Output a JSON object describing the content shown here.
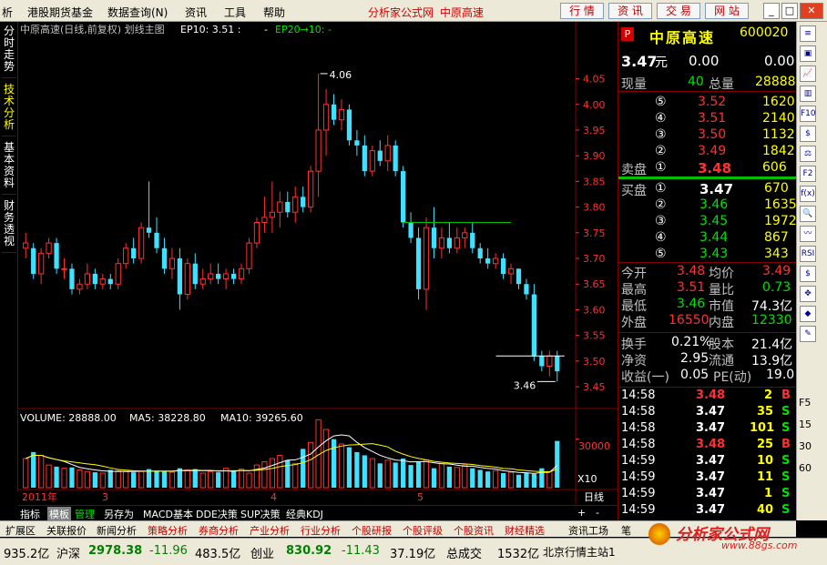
{
  "menu": {
    "items": [
      "析",
      "港股期货基金",
      "数据查询(N)",
      "资讯",
      "工具",
      "帮助"
    ],
    "brand_1": "分析家公式网",
    "brand_2": "中原高速",
    "top_buttons": [
      "行 情",
      "资 讯",
      "交 易",
      "网 站"
    ],
    "window_buttons": [
      "_",
      "□",
      "✕"
    ]
  },
  "left_tabs": [
    "分时走势",
    "技术分析",
    "基本资料",
    "财务透视"
  ],
  "chart_header": {
    "title": "中原高速(日线,前复权) 划线主图",
    "ep10": "EP10: 3.51 :",
    "dash": "-",
    "ep20": "EP20→10: -"
  },
  "volume_header": {
    "volume": "VOLUME: 28888.00",
    "ma5": "MA5: 38228.80",
    "ma10": "MA10: 39265.60"
  },
  "x_axis_labels": [
    "2011年",
    "3",
    "4",
    "5"
  ],
  "period_label": "日线",
  "x10_label": "X10",
  "vol_axis_label": "30000",
  "chart_data": {
    "type": "candlestick",
    "price_ylim": [
      3.42,
      4.09
    ],
    "price_ticks": [
      "4.05",
      "4.00",
      "3.95",
      "3.90",
      "3.85",
      "3.80",
      "3.75",
      "3.70",
      "3.65",
      "3.60",
      "3.55",
      "3.50",
      "3.45"
    ],
    "high_label": "4.06",
    "low_label": "3.46",
    "candles": [
      [
        3.73,
        3.75,
        3.7,
        3.72,
        1
      ],
      [
        3.72,
        3.73,
        3.66,
        3.67,
        0
      ],
      [
        3.67,
        3.72,
        3.65,
        3.71,
        1
      ],
      [
        3.71,
        3.74,
        3.7,
        3.73,
        1
      ],
      [
        3.73,
        3.74,
        3.67,
        3.68,
        0
      ],
      [
        3.68,
        3.7,
        3.66,
        3.68,
        1
      ],
      [
        3.68,
        3.69,
        3.63,
        3.64,
        0
      ],
      [
        3.64,
        3.66,
        3.63,
        3.65,
        1
      ],
      [
        3.65,
        3.69,
        3.64,
        3.67,
        1
      ],
      [
        3.67,
        3.68,
        3.64,
        3.65,
        0
      ],
      [
        3.65,
        3.67,
        3.64,
        3.66,
        1
      ],
      [
        3.66,
        3.67,
        3.64,
        3.65,
        0
      ],
      [
        3.65,
        3.7,
        3.64,
        3.69,
        1
      ],
      [
        3.69,
        3.73,
        3.68,
        3.72,
        1
      ],
      [
        3.72,
        3.74,
        3.69,
        3.7,
        0
      ],
      [
        3.7,
        3.77,
        3.69,
        3.76,
        1
      ],
      [
        3.76,
        3.85,
        3.74,
        3.75,
        0
      ],
      [
        3.75,
        3.78,
        3.71,
        3.72,
        0
      ],
      [
        3.72,
        3.74,
        3.67,
        3.68,
        0
      ],
      [
        3.68,
        3.72,
        3.66,
        3.7,
        1
      ],
      [
        3.7,
        3.72,
        3.6,
        3.63,
        0
      ],
      [
        3.63,
        3.7,
        3.62,
        3.69,
        1
      ],
      [
        3.69,
        3.71,
        3.64,
        3.65,
        0
      ],
      [
        3.65,
        3.68,
        3.64,
        3.66,
        1
      ],
      [
        3.66,
        3.69,
        3.65,
        3.67,
        1
      ],
      [
        3.67,
        3.69,
        3.65,
        3.66,
        0
      ],
      [
        3.66,
        3.68,
        3.64,
        3.67,
        1
      ],
      [
        3.67,
        3.68,
        3.65,
        3.66,
        0
      ],
      [
        3.66,
        3.69,
        3.65,
        3.68,
        1
      ],
      [
        3.68,
        3.74,
        3.67,
        3.73,
        1
      ],
      [
        3.73,
        3.78,
        3.72,
        3.77,
        1
      ],
      [
        3.77,
        3.82,
        3.75,
        3.78,
        1
      ],
      [
        3.78,
        3.85,
        3.75,
        3.79,
        1
      ],
      [
        3.79,
        3.83,
        3.76,
        3.81,
        1
      ],
      [
        3.81,
        3.83,
        3.78,
        3.79,
        0
      ],
      [
        3.79,
        3.84,
        3.77,
        3.82,
        1
      ],
      [
        3.82,
        3.84,
        3.79,
        3.8,
        0
      ],
      [
        3.8,
        3.88,
        3.79,
        3.87,
        1
      ],
      [
        3.87,
        4.06,
        3.82,
        3.95,
        1
      ],
      [
        3.95,
        4.03,
        3.9,
        4.0,
        1
      ],
      [
        4.0,
        4.02,
        3.96,
        3.97,
        0
      ],
      [
        3.97,
        4.01,
        3.95,
        3.99,
        1
      ],
      [
        3.99,
        4.0,
        3.92,
        3.93,
        0
      ],
      [
        3.93,
        3.95,
        3.9,
        3.92,
        0
      ],
      [
        3.92,
        3.94,
        3.86,
        3.87,
        0
      ],
      [
        3.87,
        3.92,
        3.86,
        3.91,
        1
      ],
      [
        3.91,
        3.93,
        3.88,
        3.89,
        0
      ],
      [
        3.89,
        3.94,
        3.87,
        3.92,
        1
      ],
      [
        3.92,
        3.93,
        3.86,
        3.87,
        0
      ],
      [
        3.87,
        3.88,
        3.76,
        3.77,
        0
      ],
      [
        3.77,
        3.79,
        3.73,
        3.74,
        0
      ],
      [
        3.74,
        3.76,
        3.62,
        3.64,
        0
      ],
      [
        3.64,
        3.78,
        3.6,
        3.76,
        1
      ],
      [
        3.76,
        3.8,
        3.7,
        3.72,
        0
      ],
      [
        3.72,
        3.76,
        3.7,
        3.74,
        1
      ],
      [
        3.74,
        3.77,
        3.71,
        3.72,
        0
      ],
      [
        3.72,
        3.76,
        3.71,
        3.74,
        1
      ],
      [
        3.74,
        3.76,
        3.72,
        3.75,
        1
      ],
      [
        3.75,
        3.77,
        3.71,
        3.72,
        0
      ],
      [
        3.72,
        3.73,
        3.69,
        3.7,
        0
      ],
      [
        3.7,
        3.72,
        3.68,
        3.69,
        0
      ],
      [
        3.69,
        3.71,
        3.68,
        3.7,
        1
      ],
      [
        3.7,
        3.71,
        3.66,
        3.67,
        0
      ],
      [
        3.67,
        3.69,
        3.65,
        3.68,
        1
      ],
      [
        3.68,
        3.68,
        3.64,
        3.65,
        0
      ],
      [
        3.65,
        3.66,
        3.62,
        3.63,
        0
      ],
      [
        3.63,
        3.65,
        3.5,
        3.51,
        0
      ],
      [
        3.51,
        3.52,
        3.48,
        3.49,
        0
      ],
      [
        3.49,
        3.52,
        3.47,
        3.51,
        1
      ],
      [
        3.51,
        3.52,
        3.46,
        3.48,
        0
      ]
    ],
    "support_line": 3.51,
    "resistance_line": 3.77,
    "volume_ylim": [
      0,
      45000
    ],
    "volumes": [
      18000,
      22000,
      20000,
      14000,
      13000,
      12000,
      12500,
      11000,
      10000,
      9500,
      9000,
      11000,
      10500,
      10000,
      9500,
      10000,
      11500,
      10500,
      10000,
      9500,
      12000,
      11000,
      11500,
      9000,
      10000,
      9500,
      12000,
      10000,
      11500,
      9000,
      14000,
      16000,
      18000,
      20000,
      17000,
      15000,
      24000,
      28000,
      42000,
      36000,
      30000,
      27000,
      25000,
      22000,
      20000,
      18000,
      15000,
      17000,
      15500,
      18000,
      14000,
      16000,
      17000,
      12000,
      15000,
      13000,
      12500,
      14000,
      12000,
      11000,
      10000,
      10500,
      9000,
      9500,
      8000,
      9000,
      8500,
      12000,
      10000,
      28888
    ],
    "series": [
      {
        "name": "MA5",
        "values": [
          38228.8
        ]
      },
      {
        "name": "MA10",
        "values": [
          39265.6
        ]
      }
    ]
  },
  "quote": {
    "flag": "P",
    "name": "中原高速",
    "code": "600020",
    "price": "3.47",
    "unit": "元",
    "change": "0.00",
    "pct": "0.00",
    "xianliang_label": "现量",
    "xianliang": "40",
    "zongliang_label": "总量",
    "zongliang": "28888",
    "sell_label": "卖盘",
    "buy_label": "买盘",
    "asks": [
      {
        "lvl": "⑤",
        "price": "3.52",
        "vol": "1620"
      },
      {
        "lvl": "④",
        "price": "3.51",
        "vol": "2140"
      },
      {
        "lvl": "③",
        "price": "3.50",
        "vol": "1132"
      },
      {
        "lvl": "②",
        "price": "3.49",
        "vol": "1842"
      },
      {
        "lvl": "①",
        "price": "3.48",
        "vol": "606"
      }
    ],
    "bids": [
      {
        "lvl": "①",
        "price": "3.47",
        "vol": "670"
      },
      {
        "lvl": "②",
        "price": "3.46",
        "vol": "1635"
      },
      {
        "lvl": "③",
        "price": "3.45",
        "vol": "1972"
      },
      {
        "lvl": "④",
        "price": "3.44",
        "vol": "867"
      },
      {
        "lvl": "⑤",
        "price": "3.43",
        "vol": "343"
      }
    ],
    "stats": [
      {
        "l1": "今开",
        "v1": "3.48",
        "c1": "r",
        "l2": "均价",
        "v2": "3.49",
        "c2": "r"
      },
      {
        "l1": "最高",
        "v1": "3.51",
        "c1": "r",
        "l2": "量比",
        "v2": "0.73",
        "c2": "g"
      },
      {
        "l1": "最低",
        "v1": "3.46",
        "c1": "g",
        "l2": "市值",
        "v2": "74.3亿",
        "c2": "w"
      },
      {
        "l1": "外盘",
        "v1": "16550",
        "c1": "r",
        "l2": "内盘",
        "v2": "12330",
        "c2": "g"
      }
    ],
    "stats2": [
      {
        "l1": "换手",
        "v1": "0.21%",
        "l2": "股本",
        "v2": "21.4亿"
      },
      {
        "l1": "净资",
        "v1": "2.95",
        "l2": "流通",
        "v2": "13.9亿"
      },
      {
        "l1": "收益(一)",
        "v1": "0.05",
        "l2": "PE(动)",
        "v2": "19.0"
      }
    ],
    "ticks": [
      {
        "t": "14:58",
        "p": "3.48",
        "pc": "r",
        "v": "2",
        "s": "B",
        "sc": "r"
      },
      {
        "t": "14:58",
        "p": "3.47",
        "pc": "w",
        "v": "35",
        "s": "S",
        "sc": "g"
      },
      {
        "t": "14:58",
        "p": "3.47",
        "pc": "w",
        "v": "101",
        "s": "S",
        "sc": "g"
      },
      {
        "t": "14:58",
        "p": "3.48",
        "pc": "r",
        "v": "25",
        "s": "B",
        "sc": "r"
      },
      {
        "t": "14:59",
        "p": "3.47",
        "pc": "w",
        "v": "10",
        "s": "S",
        "sc": "g"
      },
      {
        "t": "14:59",
        "p": "3.47",
        "pc": "w",
        "v": "11",
        "s": "S",
        "sc": "g"
      },
      {
        "t": "14:59",
        "p": "3.47",
        "pc": "w",
        "v": "1",
        "s": "S",
        "sc": "g"
      },
      {
        "t": "14:59",
        "p": "3.47",
        "pc": "w",
        "v": "40",
        "s": "S",
        "sc": "g"
      }
    ]
  },
  "right_icons": [
    "≡",
    "▣",
    "📈",
    "▥",
    "F10",
    "$",
    "⚖",
    "F2",
    "f(x)",
    "🔍",
    "〰",
    "RSI",
    "$",
    "✥",
    "◆",
    "✎"
  ],
  "right_numbers": [
    "F5",
    "15",
    "30",
    "60"
  ],
  "tabs_row1": [
    "指标",
    "模板",
    "管理",
    "另存为",
    "MACD基本",
    "DDE决策",
    "SUP决策",
    "经典KDJ"
  ],
  "tabs_row1_ctrl": [
    "+",
    "-"
  ],
  "tabs_row2": [
    "扩展区",
    "关联报价",
    "新闻分析",
    "策略分析",
    "券商分析",
    "产业分析",
    "行业分析",
    "个股研报",
    "个股评级",
    "个股资讯",
    "财经精选",
    "资讯工场",
    "笔"
  ],
  "status": {
    "s1": "935.2亿",
    "s2_label": "沪深",
    "s2_val": "2978.38",
    "s2_chg": "-11.96",
    "s2_amt": "483.5亿",
    "s3_label": "创业",
    "s3_val": "830.92",
    "s3_chg": "-11.43",
    "s3_amt": "37.19亿",
    "s4_label": "总成交",
    "s4_val": "1532亿",
    "server": "北京行情主站1"
  },
  "watermark": {
    "title": "分析家公式网",
    "url": "www.88gs.com"
  }
}
